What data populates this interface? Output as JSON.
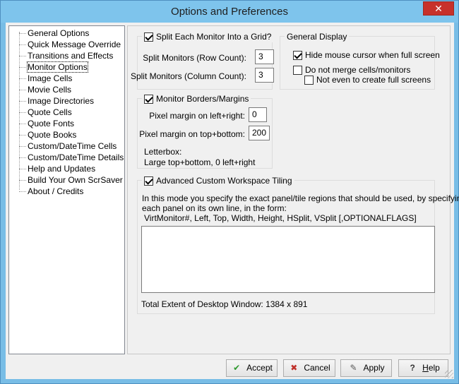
{
  "window": {
    "title": "Options and Preferences",
    "close_glyph": "✕"
  },
  "tree": {
    "items": [
      "General Options",
      "Quick Message Override",
      "Transitions and Effects",
      "Monitor Options",
      "Image Cells",
      "Movie Cells",
      "Image Directories",
      "Quote Cells",
      "Quote Fonts",
      "Quote Books",
      "Custom/DateTime Cells",
      "Custom/DateTime Details",
      "Help and Updates",
      "Build Your Own ScrSaver",
      "About / Credits"
    ],
    "selected": "Monitor Options"
  },
  "split": {
    "title": "Split Each Monitor Into a Grid?",
    "checked": true,
    "row_label": "Split Monitors (Row Count):",
    "row_value": "3",
    "col_label": "Split Monitors (Column Count):",
    "col_value": "3"
  },
  "general_display": {
    "title": "General Display",
    "hide_mouse": "Hide mouse cursor when full screen",
    "hide_mouse_checked": true,
    "no_merge": "Do not merge cells/monitors",
    "no_merge_checked": false,
    "no_fullscreens": "Not even to create full screens",
    "no_fullscreens_checked": false
  },
  "borders": {
    "title": "Monitor Borders/Margins",
    "checked": true,
    "lr_label": "Pixel margin on left+right:",
    "lr_value": "0",
    "tb_label": "Pixel margin on top+bottom:",
    "tb_value": "200",
    "letterbox_label": "Letterbox:",
    "letterbox_desc": "Large top+bottom, 0 left+right"
  },
  "tiling": {
    "title": "Advanced Custom Workspace Tiling",
    "checked": true,
    "desc_line1": "In this mode you specify the exact panel/tile regions that should be used, by specifying",
    "desc_line2": "each panel on its own line, in the form:",
    "format": "VirtMonitor#, Left, Top, Width, Height, HSplit, VSplit [,OPTIONALFLAGS]",
    "text_value": "",
    "extent": "Total Extent of Desktop Window: 1384 x 891"
  },
  "buttons": {
    "accept": "Accept",
    "cancel": "Cancel",
    "apply": "Apply",
    "help_h": "H",
    "help_rest": "elp"
  },
  "colors": {
    "titlebar": "#7ec4ec",
    "close": "#c7312a",
    "accept_icon": "#2e9b2e",
    "cancel_icon": "#c0312a"
  }
}
